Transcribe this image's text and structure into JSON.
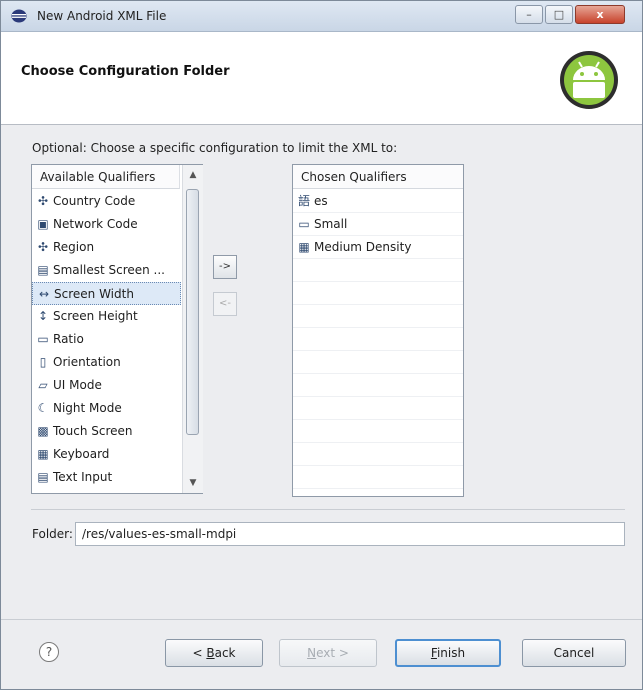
{
  "window": {
    "title": "New Android XML File",
    "buttons": {
      "minimize": "–",
      "maximize": "□",
      "close": "x"
    }
  },
  "header": {
    "title": "Choose Configuration Folder",
    "logo_icon": "android-robot-icon"
  },
  "content": {
    "optional_text": "Optional: Choose a specific configuration to limit the XML to:",
    "available": {
      "header": "Available Qualifiers",
      "items": [
        {
          "label": "Country Code",
          "icon": "country-code-icon",
          "glyph": "✣"
        },
        {
          "label": "Network Code",
          "icon": "network-code-icon",
          "glyph": "▣"
        },
        {
          "label": "Region",
          "icon": "region-icon",
          "glyph": "✣"
        },
        {
          "label": "Smallest Screen ...",
          "icon": "smallest-screen-icon",
          "glyph": "▤"
        },
        {
          "label": "Screen Width",
          "icon": "screen-width-icon",
          "glyph": "↔"
        },
        {
          "label": "Screen Height",
          "icon": "screen-height-icon",
          "glyph": "↕"
        },
        {
          "label": "Ratio",
          "icon": "ratio-icon",
          "glyph": "▭"
        },
        {
          "label": "Orientation",
          "icon": "orientation-icon",
          "glyph": "▯"
        },
        {
          "label": "UI Mode",
          "icon": "ui-mode-icon",
          "glyph": "▱"
        },
        {
          "label": "Night Mode",
          "icon": "night-mode-icon",
          "glyph": "☾"
        },
        {
          "label": "Touch Screen",
          "icon": "touch-screen-icon",
          "glyph": "▩"
        },
        {
          "label": "Keyboard",
          "icon": "keyboard-icon",
          "glyph": "▦"
        },
        {
          "label": "Text Input",
          "icon": "text-input-icon",
          "glyph": "▤"
        }
      ],
      "selected": "Screen Width"
    },
    "move_buttons": {
      "add": "->",
      "remove": "<-"
    },
    "chosen": {
      "header": "Chosen Qualifiers",
      "items": [
        {
          "label": "es",
          "icon": "language-icon",
          "glyph": "語"
        },
        {
          "label": "Small",
          "icon": "screen-size-icon",
          "glyph": "▭"
        },
        {
          "label": "Medium Density",
          "icon": "density-icon",
          "glyph": "▦"
        }
      ]
    },
    "folder": {
      "label": "Folder:",
      "value": "/res/values-es-small-mdpi"
    }
  },
  "footer": {
    "help": "?",
    "back": {
      "mnemonic": "B",
      "rest": "ack",
      "prefix": "< "
    },
    "next": {
      "mnemonic": "N",
      "rest": "ext >"
    },
    "finish": {
      "mnemonic": "F",
      "rest": "inish"
    },
    "cancel": "Cancel"
  }
}
